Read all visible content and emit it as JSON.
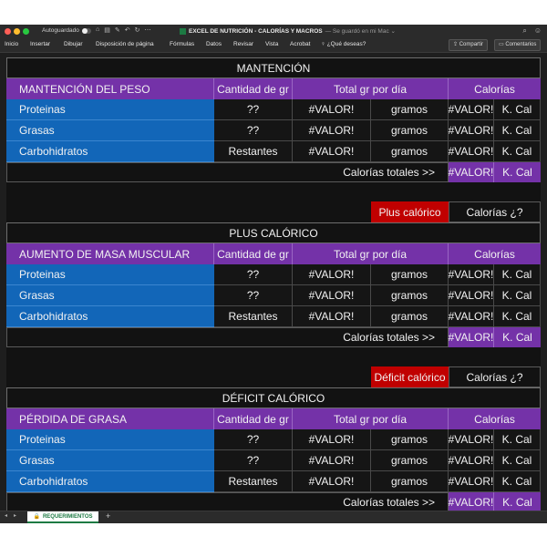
{
  "window": {
    "autosave_label": "Autoguardado",
    "doc_title": "EXCEL DE NUTRICIÓN - CALORÍAS Y MACROS",
    "save_status": "— Se guardó en mi Mac ⌄"
  },
  "ribbon": {
    "tabs": [
      "Inicio",
      "Insertar",
      "Dibujar",
      "Disposición de página",
      "Fórmulas",
      "Datos",
      "Revisar",
      "Vista",
      "Acrobat"
    ],
    "tell_me": "¿Qué deseas?",
    "share_label": "Compartir",
    "comments_label": "Comentarios"
  },
  "sections": [
    {
      "banner": "MANTENCIÓN",
      "goal": "MANTENCIÓN DEL PESO",
      "header_grams": "Cantidad de gr",
      "header_total": "Total gr por día",
      "header_cal": "Calorías",
      "rows": [
        {
          "macro": "Proteinas",
          "qty": "??",
          "total": "#VALOR!",
          "unit": "gramos",
          "kcal": "#VALOR!",
          "kunit": "K. Cal"
        },
        {
          "macro": "Grasas",
          "qty": "??",
          "total": "#VALOR!",
          "unit": "gramos",
          "kcal": "#VALOR!",
          "kunit": "K. Cal"
        },
        {
          "macro": "Carbohidratos",
          "qty": "Restantes",
          "total": "#VALOR!",
          "unit": "gramos",
          "kcal": "#VALOR!",
          "kunit": "K. Cal"
        }
      ],
      "total_label": "Calorías totales >>",
      "total_value": "#VALOR!",
      "total_unit": "K. Cal"
    },
    {
      "tag": "Plus calórico",
      "tag_question": "Calorías ¿?",
      "banner": "PLUS CALÓRICO",
      "goal": "AUMENTO DE MASA MUSCULAR",
      "header_grams": "Cantidad de gr",
      "header_total": "Total gr por día",
      "header_cal": "Calorías",
      "rows": [
        {
          "macro": "Proteinas",
          "qty": "??",
          "total": "#VALOR!",
          "unit": "gramos",
          "kcal": "#VALOR!",
          "kunit": "K. Cal"
        },
        {
          "macro": "Grasas",
          "qty": "??",
          "total": "#VALOR!",
          "unit": "gramos",
          "kcal": "#VALOR!",
          "kunit": "K. Cal"
        },
        {
          "macro": "Carbohidratos",
          "qty": "Restantes",
          "total": "#VALOR!",
          "unit": "gramos",
          "kcal": "#VALOR!",
          "kunit": "K. Cal"
        }
      ],
      "total_label": "Calorías totales >>",
      "total_value": "#VALOR!",
      "total_unit": "K. Cal"
    },
    {
      "tag": "Déficit calórico",
      "tag_question": "Calorías ¿?",
      "banner": "DÉFICIT CALÓRICO",
      "goal": "PÉRDIDA DE GRASA",
      "header_grams": "Cantidad de gr",
      "header_total": "Total gr por día",
      "header_cal": "Calorías",
      "rows": [
        {
          "macro": "Proteinas",
          "qty": "??",
          "total": "#VALOR!",
          "unit": "gramos",
          "kcal": "#VALOR!",
          "kunit": "K. Cal"
        },
        {
          "macro": "Grasas",
          "qty": "??",
          "total": "#VALOR!",
          "unit": "gramos",
          "kcal": "#VALOR!",
          "kunit": "K. Cal"
        },
        {
          "macro": "Carbohidratos",
          "qty": "Restantes",
          "total": "#VALOR!",
          "unit": "gramos",
          "kcal": "#VALOR!",
          "kunit": "K. Cal"
        }
      ],
      "total_label": "Calorías totales >>",
      "total_value": "#VALOR!",
      "total_unit": "K. Cal"
    }
  ],
  "sheet_tabs": {
    "active": "REQUERIMIENTOS",
    "add": "+"
  },
  "colors": {
    "purple_header": "#7432a8",
    "blue_macro": "#1266b8",
    "red_tag": "#c00000",
    "excel_green": "#1d7a43"
  }
}
